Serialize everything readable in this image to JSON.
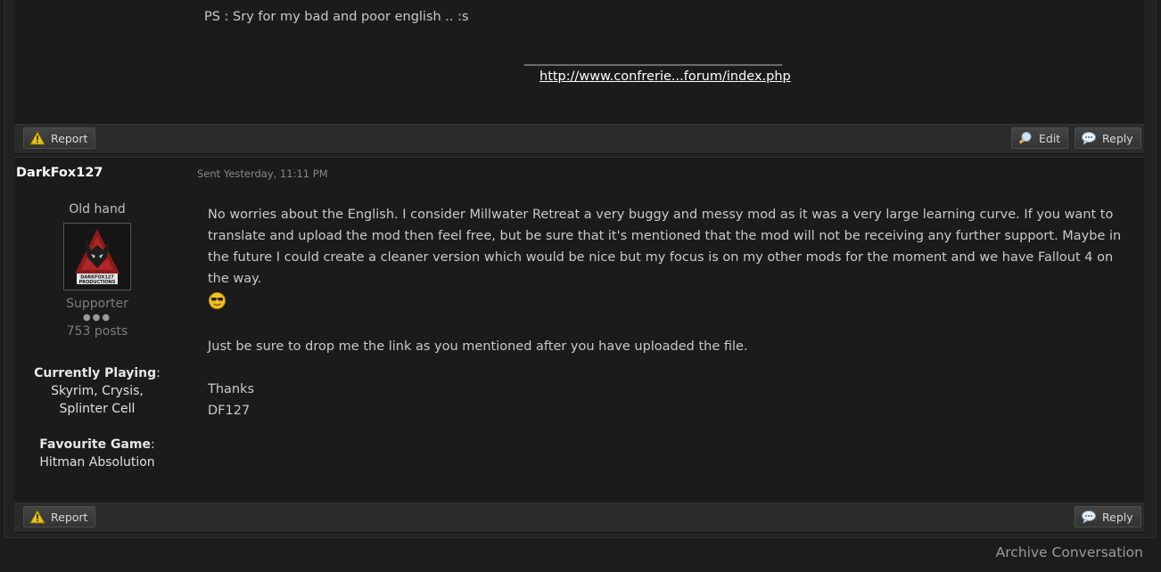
{
  "post1": {
    "ps_text": "PS : Sry for my bad and poor english .. :s",
    "signature_line": "________________________________________________",
    "signature_link": "http://www.confrerie...forum/index.php"
  },
  "actions1": {
    "report": "Report",
    "edit": "Edit",
    "reply": "Reply"
  },
  "post2": {
    "author": "DarkFox127",
    "sent": "Sent Yesterday, 11:11 PM",
    "rank": "Old hand",
    "avatar_text_line1": "DARKFOX127",
    "avatar_text_line2": "PRODUCTIONS",
    "group": "Supporter",
    "pips": "●●●",
    "post_count": "753 posts",
    "currently_playing_label": "Currently Playing",
    "currently_playing_value": "Skyrim, Crysis, Splinter Cell",
    "favourite_game_label": "Favourite Game",
    "favourite_game_value": "Hitman Absolution",
    "paragraph1": "No worries about the English. I consider Millwater Retreat a very buggy and messy mod as it was a very large learning curve. If you want to translate and upload the mod then feel free, but be sure that it's mentioned that the mod will not be receiving any further support. Maybe in the future I could create a cleaner version which would be nice but my focus is on my other mods for the moment and we have Fallout 4 on the way.",
    "paragraph2": "Just be sure to drop me the link as you mentioned after you have uploaded the file.",
    "thanks": "Thanks",
    "signoff": "DF127"
  },
  "actions2": {
    "report": "Report",
    "reply": "Reply"
  },
  "footer": {
    "archive": "Archive Conversation"
  },
  "colors": {
    "background": "#1c1c1c",
    "post_background": "#1b1b1b",
    "link": "#ffffff",
    "warning_icon": "#e8c21c"
  }
}
